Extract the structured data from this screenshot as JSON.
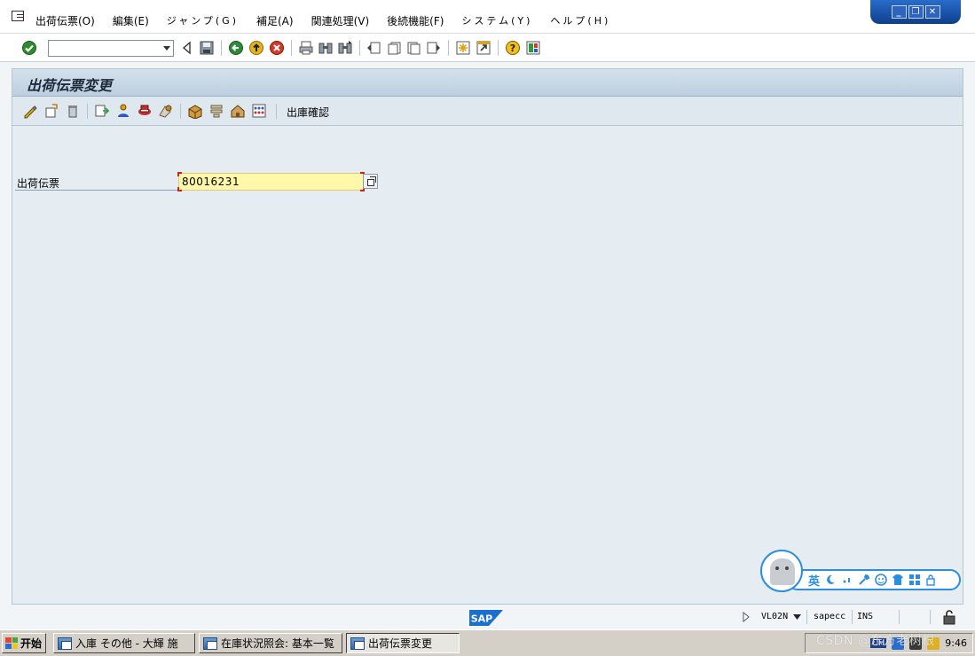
{
  "menubar": {
    "items": [
      {
        "label": "出荷伝票(O)"
      },
      {
        "label": "編集(E)"
      },
      {
        "label": "ジャンプ(G)"
      },
      {
        "label": "補足(A)"
      },
      {
        "label": "関連処理(V)"
      },
      {
        "label": "後続機能(F)"
      },
      {
        "label": "システム(Y)"
      },
      {
        "label": "ヘルプ(H)"
      }
    ],
    "window_controls": {
      "minimize": "_",
      "restore": "❐",
      "close": "✕"
    }
  },
  "toolbar": {
    "command_field_value": "",
    "icons": [
      "enter-icon",
      "back-arrow-icon",
      "save-icon",
      "back-icon",
      "exit-icon",
      "cancel-icon",
      "print-icon",
      "find-icon",
      "find-next-icon",
      "first-page-icon",
      "prev-page-icon",
      "next-page-icon",
      "last-page-icon",
      "new-session-icon",
      "shortcut-icon",
      "help-icon",
      "customize-layout-icon"
    ]
  },
  "screen": {
    "title": "出荷伝票変更",
    "app_toolbar": {
      "icons": [
        "edit-icon",
        "display-change-icon",
        "delete-icon",
        "overview-icon",
        "partner-icon",
        "header-icon",
        "texts-icon",
        "picking-icon",
        "packing-icon",
        "shipment-icon",
        "items-icon"
      ],
      "text_button": "出庫確認"
    },
    "field": {
      "label": "出荷伝票",
      "value": "80016231"
    }
  },
  "ime": {
    "mode": "英",
    "icons": [
      "moon-icon",
      "punctuation-icon",
      "wrench-icon",
      "smiley-icon",
      "shirt-icon",
      "grid-icon",
      "lock-icon"
    ]
  },
  "statusbar": {
    "logo": "SAP",
    "transaction": "VL02N",
    "server": "sapecc",
    "mode": "INS"
  },
  "taskbar": {
    "start": "开始",
    "tasks": [
      {
        "label": "入庫 その他 - 大輝 施"
      },
      {
        "label": "在庫状況照会: 基本一覧"
      },
      {
        "label": "出荷伝票変更"
      }
    ],
    "tray_time": "9:46",
    "tray_lang": "CH"
  },
  "watermark": "CSDN @东方老树根"
}
